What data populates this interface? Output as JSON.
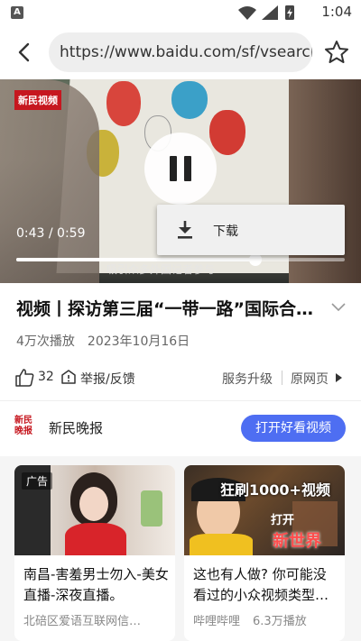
{
  "status_bar": {
    "notification_letter": "A",
    "time": "1:04"
  },
  "browser": {
    "url": "https://www.baidu.com/sf/vsearch"
  },
  "video": {
    "badge": "新民视频",
    "current_time": "0:43",
    "duration": "0:59",
    "time_display": "0:43 / 0:59",
    "progress": 0.729,
    "caption": "吸引众多外国记者参与"
  },
  "context_menu": {
    "items": [
      {
        "label": "下载",
        "icon": "download-icon"
      }
    ]
  },
  "article": {
    "title": "视频丨探访第三届“一带一路”国际合…",
    "views": "4万次播放",
    "date": "2023年10月16日"
  },
  "actions": {
    "like_count": "32",
    "report_label": "举报/反馈",
    "upgrade_label": "服务升级",
    "original_label": "原网页"
  },
  "source": {
    "logo_text": "新民晚报",
    "name": "新民晚报",
    "open_button": "打开好看视频"
  },
  "recommendations": [
    {
      "tag": "广告",
      "title": "南昌-害羞男士勿入-美女直播-深夜直播。",
      "meta": [
        "北碚区爱语互联网信…"
      ]
    },
    {
      "thumb_text_top": "狂刷1000+视频",
      "thumb_text_mid": "打开",
      "thumb_text_bottom": "新世界",
      "title": "这也有人做? 你可能没看过的小众视频类型…",
      "meta": [
        "哔哩哔哩",
        "6.3万播放"
      ]
    }
  ],
  "colors": {
    "accent": "#4e6ef2",
    "brand_red": "#c6171f",
    "background": "#ffffff"
  }
}
